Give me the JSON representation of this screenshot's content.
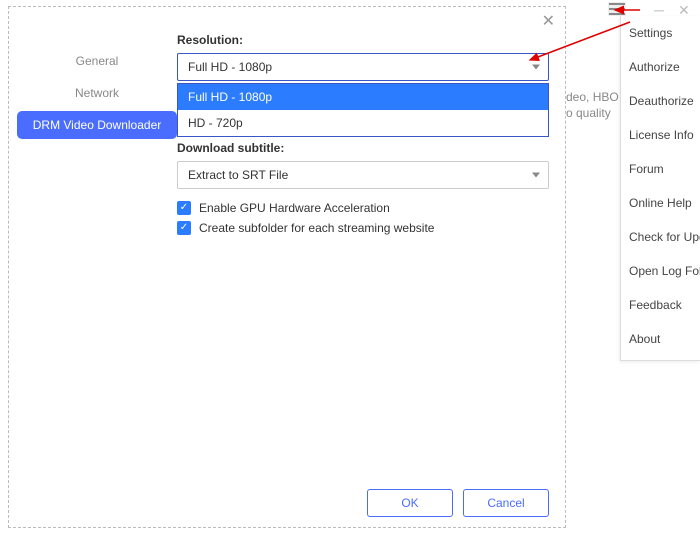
{
  "sidebar": {
    "items": [
      {
        "label": "General"
      },
      {
        "label": "Network"
      },
      {
        "label": "DRM Video Downloader"
      }
    ]
  },
  "resolution": {
    "label": "Resolution:",
    "value": "Full HD - 1080p",
    "options": [
      "Full HD - 1080p",
      "HD - 720p"
    ]
  },
  "subtitle": {
    "label": "Download subtitle:",
    "value": "Extract to SRT File"
  },
  "checkboxes": {
    "gpu": "Enable GPU Hardware Acceleration",
    "subfolder": "Create subfolder for each streaming website"
  },
  "buttons": {
    "ok": "OK",
    "cancel": "Cancel"
  },
  "menu": {
    "items": [
      "Settings",
      "Authorize",
      "Deauthorize",
      "License Info",
      "Forum",
      "Online Help",
      "Check for Updates",
      "Open Log Folder",
      "Feedback",
      "About"
    ]
  },
  "bgtext": {
    "l1": "deo, HBO",
    "l2": "o quality"
  }
}
